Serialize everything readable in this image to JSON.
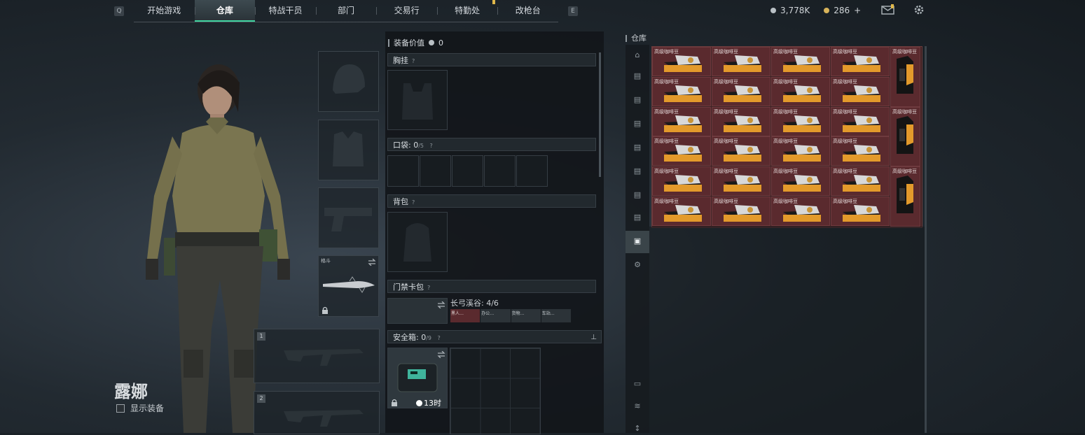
{
  "nav": {
    "left_key": "Q",
    "right_key": "E",
    "tabs": [
      {
        "label": "开始游戏"
      },
      {
        "label": "仓库"
      },
      {
        "label": "特战干员"
      },
      {
        "label": "部门"
      },
      {
        "label": "交易行"
      },
      {
        "label": "特勤处"
      },
      {
        "label": "改枪台"
      }
    ],
    "active_tab": "仓库"
  },
  "currency": {
    "primary": "3,778K",
    "secondary": "286",
    "add_label": "+"
  },
  "character": {
    "name": "露娜",
    "show_equipment_label": "显示装备"
  },
  "equipment": {
    "melee_label": "格斗",
    "weapon_slot_1": "1",
    "weapon_slot_2": "2"
  },
  "loadout": {
    "value_label": "装备价值",
    "value": "0",
    "chest_rig_label": "胸挂",
    "pocket_label": "口袋:",
    "pocket_count": "0",
    "pocket_capacity": "/5",
    "backpack_label": "背包",
    "keycard_label": "门禁卡包",
    "keycard_name": "长弓溪谷: 4/6",
    "keycard_items": [
      "黑人…",
      "办公…",
      "货物…",
      "车站…"
    ],
    "safe_label": "安全箱:",
    "safe_count": "0",
    "safe_capacity": "/9",
    "safe_timer": "13时"
  },
  "warehouse": {
    "title": "仓库",
    "item_label": "高级咖啡豆",
    "grid_rows": 6,
    "box_columns": 4,
    "pack_label": "高级咖啡豆"
  },
  "colors": {
    "accent": "#3fd4a0",
    "item_bg": "#5a2a2e",
    "notify": "#e0b84a"
  }
}
